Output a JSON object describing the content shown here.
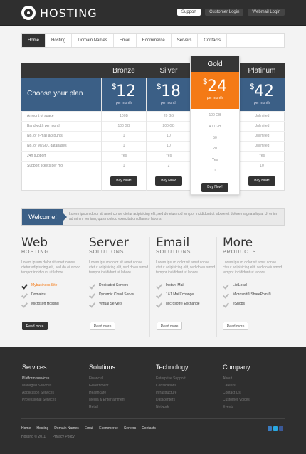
{
  "brand": {
    "name": "HOSTING"
  },
  "top_links": [
    "Support",
    "Customer Login",
    "Webmail Login"
  ],
  "nav": [
    "Home",
    "Hosting",
    "Domain Names",
    "Email",
    "Ecommerce",
    "Servers",
    "Contacts"
  ],
  "pricing": {
    "choose_label": "Choose your plan",
    "row_labels": [
      "Amount of space",
      "Bandwidth per month",
      "No. of e-mail accounts",
      "No. of MySQL databases",
      "24h support",
      "Support tickets per mo."
    ],
    "plans": [
      {
        "name": "Bronze",
        "currency": "$",
        "price": "12",
        "per": "per month",
        "values": [
          "100B",
          "100 GB",
          "1",
          "1",
          "Yes",
          "1"
        ],
        "button": "Buy Now!"
      },
      {
        "name": "Silver",
        "currency": "$",
        "price": "18",
        "per": "per month",
        "values": [
          "20 GB",
          "200 GB",
          "10",
          "10",
          "Yes",
          "2"
        ],
        "button": "Buy Now!"
      },
      {
        "name": "Gold",
        "currency": "$",
        "price": "24",
        "per": "per month",
        "values": [
          "100 GB",
          "400 GB",
          "50",
          "20",
          "Yes",
          "1"
        ],
        "button": "Buy Now!"
      },
      {
        "name": "Platinum",
        "currency": "$",
        "price": "42",
        "per": "per month",
        "values": [
          "Unlimited",
          "Unlimited",
          "Unlimited",
          "Unlimited",
          "Yes",
          "10"
        ],
        "button": "Buy Now!"
      }
    ]
  },
  "welcome": {
    "tag": "Welcome!",
    "text": "Lorem ipsum dolor sit amet conse ctetur adipisicing elit, sed do eiusmod tempor incididunt ut labore et dolore magna aliqua. Ut enim ad minim veniam, quis nostrud exercitation ullamco laboris."
  },
  "features": [
    {
      "title": "Web",
      "subtitle": "HOSTING",
      "desc": "Lorem ipsum dolor sit amet conse ctetur adipisicing elit, sed do eiusmod tempor incididunt ut labore",
      "items": [
        "Mybusiness Site",
        "Domains",
        "Microsoft Hosting"
      ],
      "button": "Read more"
    },
    {
      "title": "Server",
      "subtitle": "SOLUTIONS",
      "desc": "Lorem ipsum dolor sit amet conse ctetur adipisicing elit, sed do eiusmod tempor incididunt ut labore",
      "items": [
        "Dedicated Servers",
        "Dynamic Cloud Server",
        "Virtual Servers"
      ],
      "button": "Read more"
    },
    {
      "title": "Email",
      "subtitle": "SOLUTIONS",
      "desc": "Lorem ipsum dolor sit amet conse ctetur adipisicing elit, sed do eiusmod tempor incididunt ut labore",
      "items": [
        "Instant Mail",
        "1&1 MailXchange",
        "Microsoft® Exchange"
      ],
      "button": "Read more"
    },
    {
      "title": "More",
      "subtitle": "PRODUCTS",
      "desc": "Lorem ipsum dolor sit amet conse ctetur adipisicing elit, sed do eiusmod tempor incididunt ut labore",
      "items": [
        "ListLocal",
        "Microsoft® SharePoint®",
        "eShops"
      ],
      "button": "Read more"
    }
  ],
  "footer": {
    "columns": [
      {
        "title": "Services",
        "links": [
          "Platform services",
          "Managed Services",
          "Application Services",
          "Professional Services"
        ]
      },
      {
        "title": "Solutions",
        "links": [
          "Financial",
          "Government",
          "Healthcare",
          "Media & Entertainment",
          "Retail"
        ]
      },
      {
        "title": "Technology",
        "links": [
          "Enterprise Support",
          "Certifications",
          "Infrastructure",
          "Datacenters",
          "Network"
        ]
      },
      {
        "title": "Company",
        "links": [
          "About",
          "Careers",
          "Contact Us",
          "Customer Voices",
          "Events"
        ]
      }
    ],
    "nav": [
      "Home",
      "Hosting",
      "Domain Names",
      "Email",
      "Ecommerce",
      "Servers",
      "Contacts"
    ],
    "copyright": "Hosting © 2011",
    "privacy": "Privacy Policy"
  },
  "colors": {
    "accent": "#f47a16",
    "blue": "#3b5f86",
    "dark": "#2f2f2f"
  }
}
